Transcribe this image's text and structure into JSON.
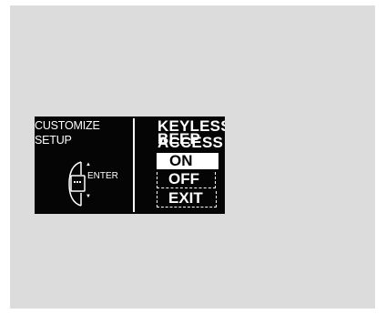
{
  "left_panel": {
    "title_line1": "CUSTOMIZE",
    "title_line2": "SETUP",
    "enter_label": "ENTER",
    "arrow_up": "▲",
    "arrow_down": "▼"
  },
  "main_panel": {
    "heading_line1": "KEYLESS ACCESS",
    "heading_line2": "BEEP",
    "options": [
      {
        "label": "ON",
        "selected": true
      },
      {
        "label": "OFF",
        "selected": false
      },
      {
        "label": "EXIT",
        "selected": false
      }
    ]
  },
  "colors": {
    "display_bg": "#050505",
    "frame_bg": "#dcdcdc",
    "text": "#ffffff"
  }
}
